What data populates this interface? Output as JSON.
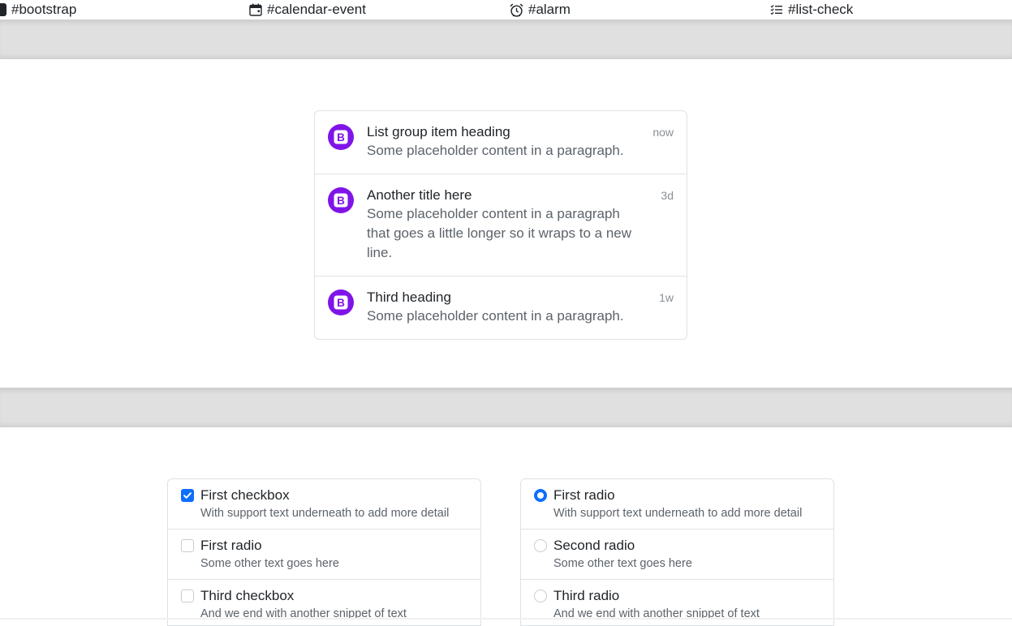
{
  "topbar": {
    "items": [
      {
        "label": "#bootstrap",
        "icon": "bootstrap-icon"
      },
      {
        "label": "#calendar-event",
        "icon": "calendar-event-icon"
      },
      {
        "label": "#alarm",
        "icon": "alarm-icon"
      },
      {
        "label": "#list-check",
        "icon": "list-check-icon"
      }
    ]
  },
  "colors": {
    "accent": "#0d6efd",
    "bootstrap_purple": "#7f14e8",
    "divider": "#e0e0e0",
    "border": "#dee2e6"
  },
  "list_group": {
    "items": [
      {
        "icon": "bootstrap-icon",
        "heading": "List group item heading",
        "text": "Some placeholder content in a paragraph.",
        "time": "now"
      },
      {
        "icon": "bootstrap-icon",
        "heading": "Another title here",
        "text": "Some placeholder content in a paragraph that goes a little longer so it wraps to a new line.",
        "time": "3d"
      },
      {
        "icon": "bootstrap-icon",
        "heading": "Third heading",
        "text": "Some placeholder content in a paragraph.",
        "time": "1w"
      }
    ]
  },
  "checkbox_group": {
    "items": [
      {
        "label": "First checkbox",
        "sub": "With support text underneath to add more detail",
        "checked": true
      },
      {
        "label": "First radio",
        "sub": "Some other text goes here",
        "checked": false
      },
      {
        "label": "Third checkbox",
        "sub": "And we end with another snippet of text",
        "checked": false
      }
    ]
  },
  "radio_group": {
    "items": [
      {
        "label": "First radio",
        "sub": "With support text underneath to add more detail",
        "checked": true
      },
      {
        "label": "Second radio",
        "sub": "Some other text goes here",
        "checked": false
      },
      {
        "label": "Third radio",
        "sub": "And we end with another snippet of text",
        "checked": false
      }
    ]
  }
}
